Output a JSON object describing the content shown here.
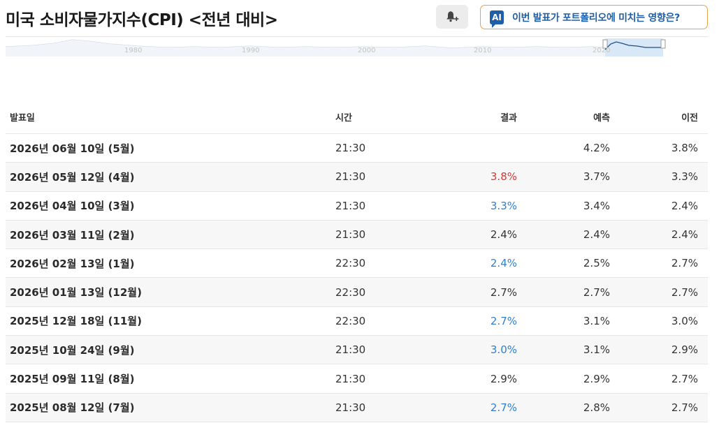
{
  "header": {
    "title": "미국 소비자물가지수(CPI) <전년 대비>",
    "ai_badge": "AI",
    "ai_button_label": "이번 발표가 포트폴리오에 미치는 영향은?",
    "alert_icon": "bell-plus-icon"
  },
  "timeline": {
    "year_labels": [
      "1980",
      "1990",
      "2000",
      "2010",
      "2020"
    ]
  },
  "table": {
    "columns": {
      "date": "발표일",
      "time": "시간",
      "actual": "결과",
      "forecast": "예측",
      "previous": "이전"
    },
    "rows": [
      {
        "date": "2026년 06월 10일 (5월)",
        "time": "21:30",
        "actual": "",
        "actual_status": "neutral",
        "forecast": "4.2%",
        "previous": "3.8%"
      },
      {
        "date": "2026년 05월 12일 (4월)",
        "time": "21:30",
        "actual": "3.8%",
        "actual_status": "up",
        "forecast": "3.7%",
        "previous": "3.3%"
      },
      {
        "date": "2026년 04월 10일 (3월)",
        "time": "21:30",
        "actual": "3.3%",
        "actual_status": "down",
        "forecast": "3.4%",
        "previous": "2.4%"
      },
      {
        "date": "2026년 03월 11일 (2월)",
        "time": "21:30",
        "actual": "2.4%",
        "actual_status": "neutral",
        "forecast": "2.4%",
        "previous": "2.4%"
      },
      {
        "date": "2026년 02월 13일 (1월)",
        "time": "22:30",
        "actual": "2.4%",
        "actual_status": "down",
        "forecast": "2.5%",
        "previous": "2.7%"
      },
      {
        "date": "2026년 01월 13일 (12월)",
        "time": "22:30",
        "actual": "2.7%",
        "actual_status": "neutral",
        "forecast": "2.7%",
        "previous": "2.7%"
      },
      {
        "date": "2025년 12월 18일 (11월)",
        "time": "22:30",
        "actual": "2.7%",
        "actual_status": "down",
        "forecast": "3.1%",
        "previous": "3.0%"
      },
      {
        "date": "2025년 10월 24일 (9월)",
        "time": "21:30",
        "actual": "3.0%",
        "actual_status": "down",
        "forecast": "3.1%",
        "previous": "2.9%"
      },
      {
        "date": "2025년 09월 11일 (8월)",
        "time": "21:30",
        "actual": "2.9%",
        "actual_status": "neutral",
        "forecast": "2.9%",
        "previous": "2.7%"
      },
      {
        "date": "2025년 08월 12일 (7월)",
        "time": "21:30",
        "actual": "2.7%",
        "actual_status": "down",
        "forecast": "2.8%",
        "previous": "2.7%"
      }
    ]
  },
  "colors": {
    "up": "#d93636",
    "down": "#2f7fd0",
    "accent": "#1f5fa8",
    "ai_border": "#e8a24a"
  }
}
